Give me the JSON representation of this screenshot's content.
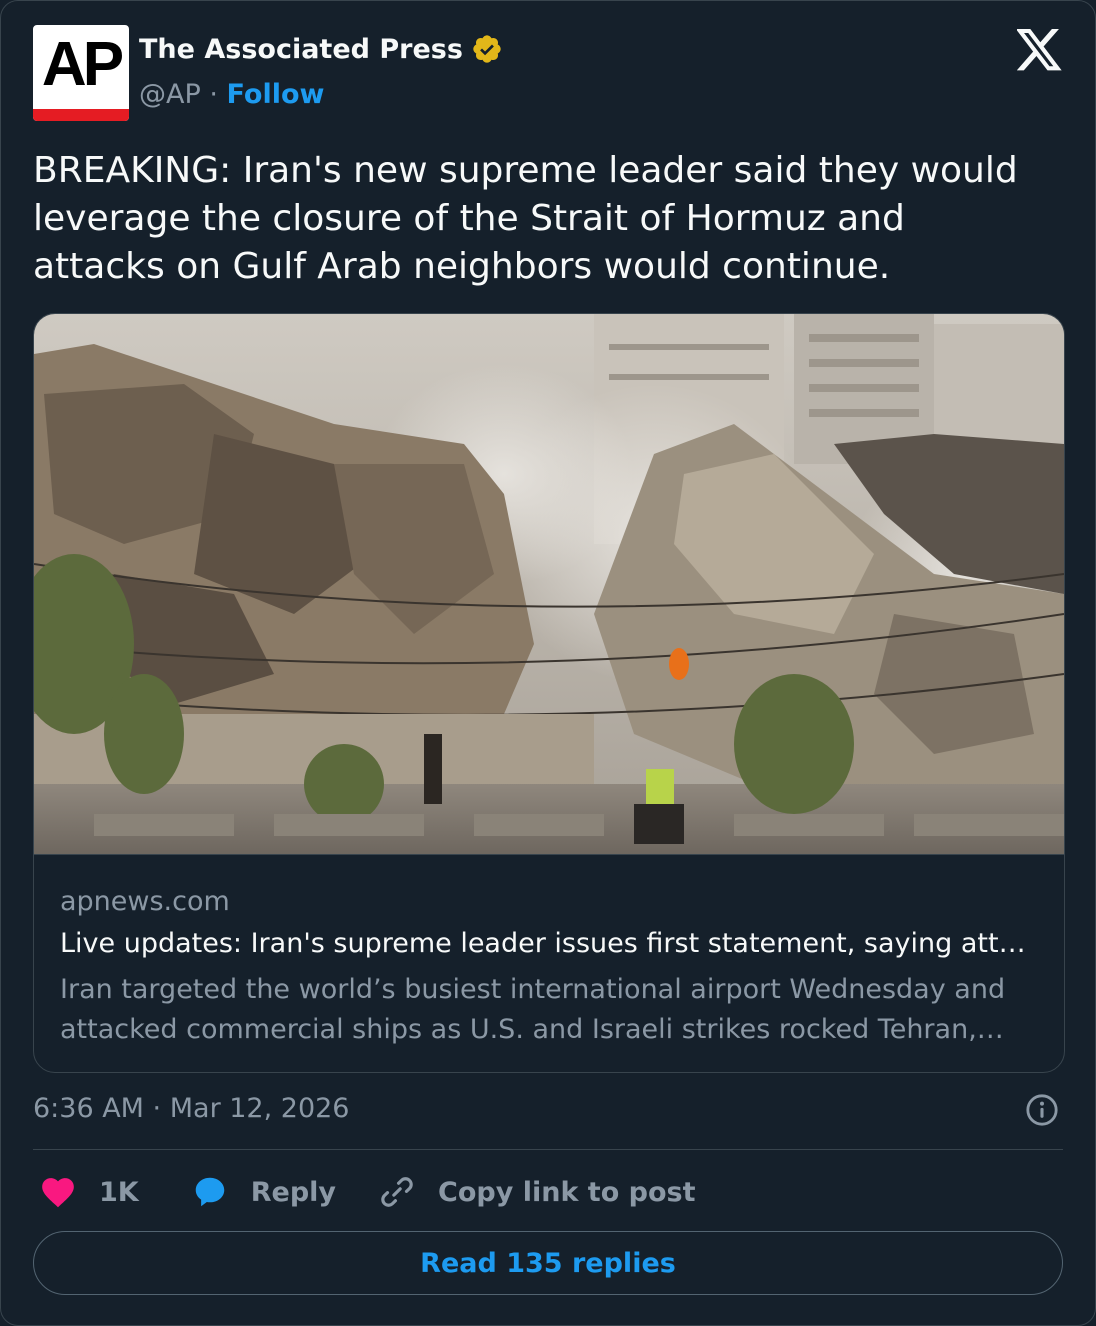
{
  "author": {
    "avatar_text": "AP",
    "name": "The Associated Press",
    "handle": "@AP",
    "separator": "·",
    "follow_label": "Follow",
    "verified_icon": "verified-badge-gold",
    "avatar_bar_color": "#e51c23"
  },
  "tweet": {
    "text": "BREAKING: Iran's new supreme leader said they would leverage the closure of the Strait of Hormuz and attacks on Gulf Arab neighbors would continue."
  },
  "link_card": {
    "image_icon": "photo-collapsed-buildings",
    "domain": "apnews.com",
    "headline": "Live updates: Iran's supreme leader issues first statement, saying attacks …",
    "description": "Iran targeted the world’s busiest international airport Wednesday and attacked commercial ships as U.S. and Israeli strikes rocked Tehran, while…"
  },
  "meta": {
    "timestamp": "6:36 AM · Mar 12, 2026",
    "info_icon": "info-icon"
  },
  "actions": {
    "like_count": "1K",
    "reply_label": "Reply",
    "copy_label": "Copy link to post",
    "like_color": "#f91880",
    "reply_color": "#1d9bf0"
  },
  "read_replies_label": "Read 135 replies",
  "colors": {
    "background": "#15202b",
    "text": "#f7f9f9",
    "secondary": "#8b98a5",
    "accent": "#1d9bf0"
  }
}
